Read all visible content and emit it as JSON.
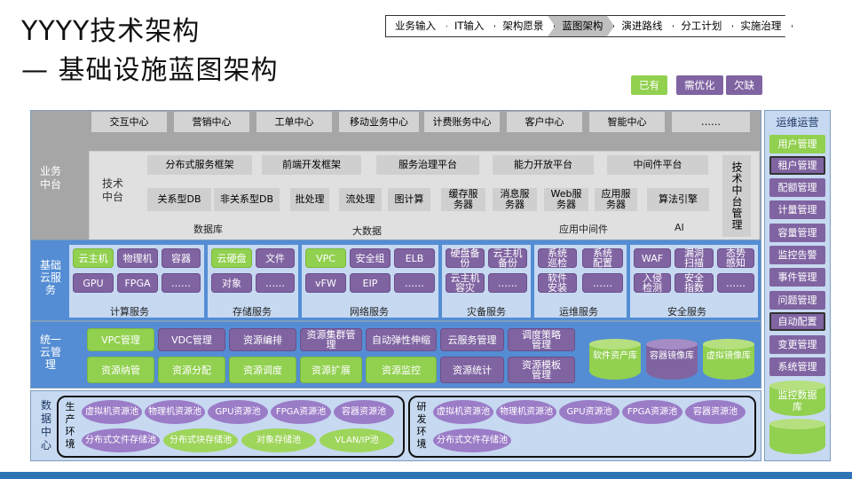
{
  "title": {
    "line1": "YYYY技术架构",
    "line2": "— 基础设施蓝图架构"
  },
  "nav": [
    "业务输入",
    "IT输入",
    "架构愿景",
    "蓝图架构",
    "演进路线",
    "分工计划",
    "实施治理"
  ],
  "nav_current": 3,
  "legend": [
    {
      "label": "已有",
      "color": "#92d050"
    },
    {
      "label": "需优化",
      "color": "#8064a2"
    },
    {
      "label": "欠缺",
      "color": "#8064a2"
    }
  ],
  "top_row": [
    "交互中心",
    "营销中心",
    "工单中心",
    "移动业务中心",
    "计费账务中心",
    "客户中心",
    "智能中心",
    "……"
  ],
  "biz_platform": {
    "label": "业务中台",
    "frameworks": [
      "分布式服务框架",
      "前端开发框架",
      "服务治理平台",
      "能力开放平台",
      "中间件平台"
    ],
    "tech_label": "技术中台",
    "tech_right": "技术中台管理",
    "db": [
      "关系型DB",
      "非关系型DB"
    ],
    "db_label": "数据库",
    "bigdata": [
      "批处理",
      "流处理",
      "图计算"
    ],
    "bigdata_label": "大数据",
    "middleware": [
      "缓存服务器",
      "消息服务器",
      "Web服务器",
      "应用服务器"
    ],
    "middleware_label": "应用中间件",
    "ai": [
      "算法引擎"
    ],
    "ai_label": "AI"
  },
  "cloud": {
    "label": "基础云服务",
    "compute": {
      "items": [
        "云主机",
        "物理机",
        "容器",
        "GPU",
        "FPGA",
        "……"
      ],
      "label": "计算服务"
    },
    "storage": {
      "items": [
        "云硬盘",
        "文件",
        "对象",
        "……"
      ],
      "label": "存储服务"
    },
    "network": {
      "items": [
        "VPC",
        "安全组",
        "ELB",
        "vFW",
        "EIP",
        "……"
      ],
      "label": "网络服务"
    },
    "dr": {
      "items": [
        "硬盘备份",
        "云主机备份",
        "云主机容灾",
        "……"
      ],
      "label": "灾备服务"
    },
    "ops": {
      "items": [
        "系统巡检",
        "系统配置",
        "软件安装",
        "……"
      ],
      "label": "运维服务"
    },
    "security": {
      "items": [
        "WAF",
        "漏洞扫描",
        "态势感知",
        "入侵检测",
        "安全指数",
        "……"
      ],
      "label": "安全服务"
    }
  },
  "unified": {
    "label": "统一云管理",
    "row1": [
      "VPC管理",
      "VDC管理",
      "资源编排",
      "资源集群管理",
      "自动弹性伸缩",
      "云服务管理",
      "调度策略管理"
    ],
    "row2": [
      "资源纳管",
      "资源分配",
      "资源调度",
      "资源扩展",
      "资源监控",
      "资源统计",
      "资源模板管理"
    ],
    "repos": [
      "软件资产库",
      "容器镜像库",
      "虚拟镜像库"
    ]
  },
  "dc": {
    "label": "数据中心",
    "prod_label": "生产环境",
    "dev_label": "研发环境",
    "pools_row1": [
      "虚拟机资源池",
      "物理机资源池",
      "GPU资源池",
      "FPGA资源池",
      "容器资源池"
    ],
    "pools_row2": [
      "分布式文件存储池",
      "分布式块存储池",
      "对象存储池",
      "VLAN/IP池"
    ],
    "dev_row2": [
      "分布式文件存储池"
    ]
  },
  "ops_side": {
    "title": "运维运营",
    "items": [
      "用户管理",
      "租户管理",
      "配额管理",
      "计量管理",
      "容量管理",
      "监控告警",
      "事件管理",
      "问题管理",
      "自动配置",
      "变更管理",
      "系统管理"
    ],
    "db": "监控数据库"
  }
}
